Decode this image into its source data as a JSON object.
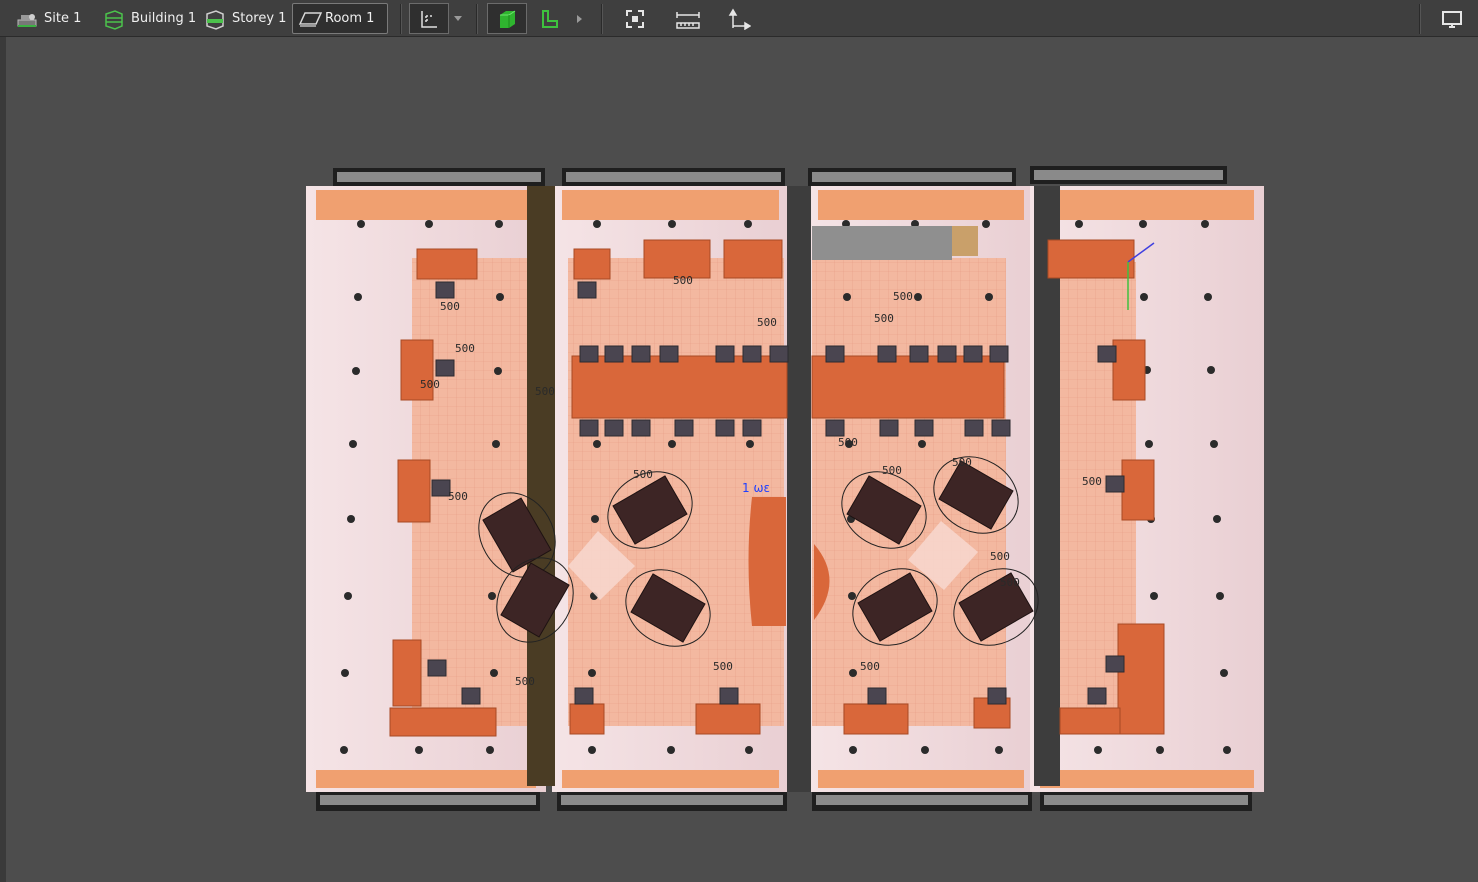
{
  "breadcrumbs": [
    {
      "label": "Site 1",
      "icon": "site-icon"
    },
    {
      "label": "Building 1",
      "icon": "building-icon"
    },
    {
      "label": "Storey 1",
      "icon": "storey-icon"
    },
    {
      "label": "Room 1",
      "icon": "room-icon",
      "active": true
    }
  ],
  "tools": {
    "floorplan": {
      "icon": "floorplan-view-icon"
    },
    "view_3d": {
      "icon": "3d-box-icon",
      "active": true
    },
    "view_2d": {
      "icon": "2d-corner-icon"
    },
    "fit": {
      "icon": "fit-to-view-icon"
    },
    "measure": {
      "icon": "measure-ruler-icon"
    },
    "dimension": {
      "icon": "dimension-arrow-icon"
    },
    "display": {
      "icon": "monitor-icon"
    }
  },
  "scene": {
    "floor_labels": [
      "500",
      "500",
      "500",
      "500",
      "500",
      "500",
      "500",
      "500",
      "500",
      "500",
      "500",
      "500",
      "500",
      "500",
      "500",
      "500",
      "500",
      "500",
      "500"
    ],
    "marker_label": "1 ωε",
    "colors": {
      "floor": "#f3b8a0",
      "wall": "#f2dadd",
      "furniture": "#d9673a",
      "chair": "#4a4550",
      "sofa": "#3d2525",
      "light": "#2b2b2b"
    }
  }
}
